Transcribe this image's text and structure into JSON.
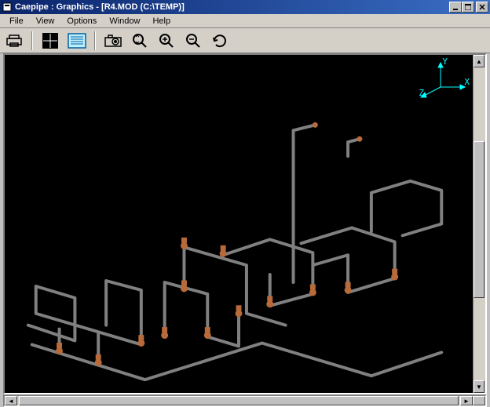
{
  "title": "Caepipe : Graphics  -  [R4.MOD (C:\\TEMP)]",
  "menu": {
    "file": "File",
    "view": "View",
    "options": "Options",
    "window": "Window",
    "help": "Help"
  },
  "axis": {
    "x": "X",
    "y": "Y",
    "z": "Z"
  },
  "icons": {
    "print": "print-icon",
    "crosshair": "crosshair-icon",
    "list": "list-icon",
    "camera": "camera-icon",
    "zoom_fit": "zoom-fit-icon",
    "zoom_in": "zoom-in-icon",
    "zoom_out": "zoom-out-icon",
    "rotate": "rotate-icon"
  },
  "colors": {
    "pipe": "#808080",
    "support": "#b86a3a",
    "axis": "#00ffff",
    "viewport_bg": "#000000"
  }
}
